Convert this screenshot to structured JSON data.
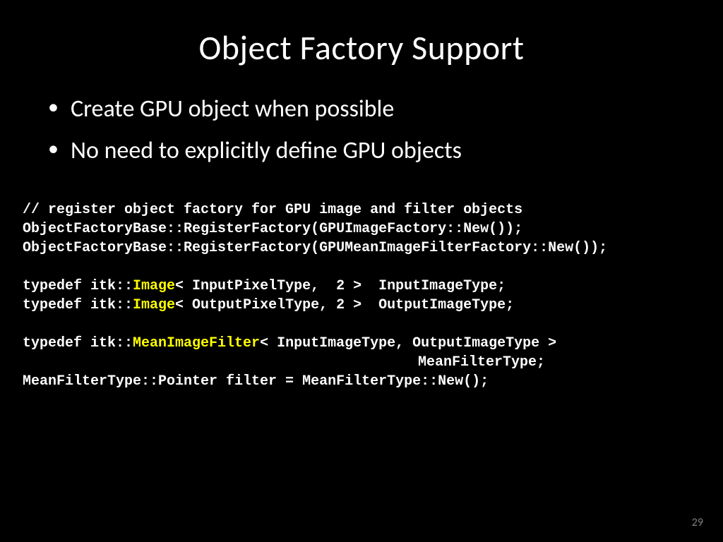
{
  "title": "Object Factory Support",
  "bullets": [
    "Create GPU object when possible",
    "No need to explicitly define GPU objects"
  ],
  "code": {
    "c1": "// register object factory for GPU image and filter objects",
    "c2": "ObjectFactoryBase::RegisterFactory(GPUImageFactory::New());",
    "c3": "ObjectFactoryBase::RegisterFactory(GPUMeanImageFilterFactory::New());",
    "c4a": "typedef itk::",
    "c4h": "Image",
    "c4b": "< InputPixelType,  2 >  InputImageType;",
    "c5a": "typedef itk::",
    "c5h": "Image",
    "c5b": "< OutputPixelType, 2 >  OutputImageType;",
    "c6a": "typedef itk::",
    "c6h": "MeanImageFilter",
    "c6b": "< InputImageType, OutputImageType >",
    "c7": "MeanFilterType;",
    "c8": "MeanFilterType::Pointer filter = MeanFilterType::New();"
  },
  "page": "29"
}
